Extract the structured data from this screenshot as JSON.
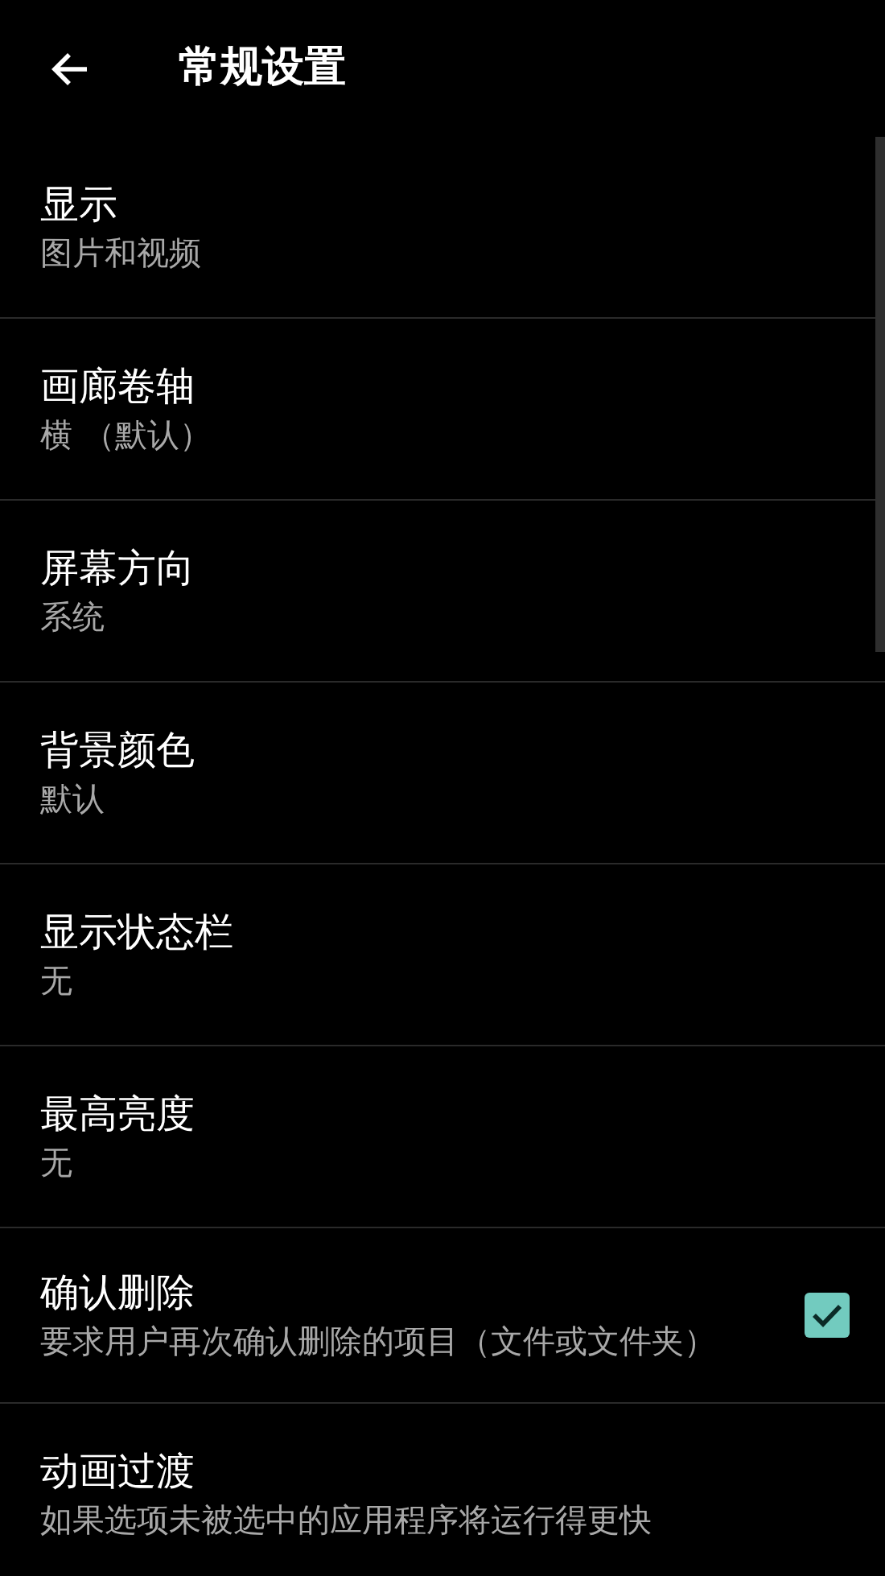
{
  "header": {
    "title": "常规设置"
  },
  "items": [
    {
      "kind": "text",
      "title": "显示",
      "subtitle": "图片和视频"
    },
    {
      "kind": "text",
      "title": "画廊卷轴",
      "subtitle": "横 （默认）"
    },
    {
      "kind": "text",
      "title": "屏幕方向",
      "subtitle": "系统"
    },
    {
      "kind": "text",
      "title": "背景颜色",
      "subtitle": "默认"
    },
    {
      "kind": "text",
      "title": "显示状态栏",
      "subtitle": "无"
    },
    {
      "kind": "text",
      "title": "最高亮度",
      "subtitle": "无"
    },
    {
      "kind": "checkbox",
      "title": "确认删除",
      "subtitle": "要求用户再次确认删除的项目（文件或文件夹）",
      "checked": true
    },
    {
      "kind": "text",
      "title": "动画过渡",
      "subtitle": "如果选项未被选中的应用程序将运行得更快"
    }
  ]
}
